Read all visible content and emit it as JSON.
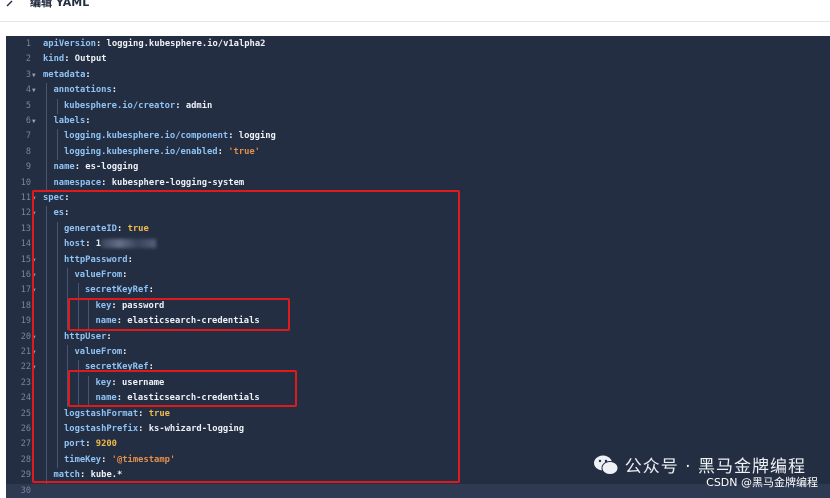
{
  "header": {
    "title": "编辑 YAML"
  },
  "editor": {
    "lines": [
      {
        "n": "1",
        "fold": "",
        "indent": 0,
        "parts": [
          [
            "key",
            "apiVersion"
          ],
          [
            "plain",
            ": logging.kubesphere.io/v1alpha2"
          ]
        ]
      },
      {
        "n": "2",
        "fold": "",
        "indent": 0,
        "parts": [
          [
            "key",
            "kind"
          ],
          [
            "plain",
            ": Output"
          ]
        ]
      },
      {
        "n": "3",
        "fold": "▼",
        "indent": 0,
        "parts": [
          [
            "key",
            "metadata"
          ],
          [
            "plain",
            ":"
          ]
        ]
      },
      {
        "n": "4",
        "fold": "▼",
        "indent": 1,
        "parts": [
          [
            "key",
            "annotations"
          ],
          [
            "plain",
            ":"
          ]
        ]
      },
      {
        "n": "5",
        "fold": "",
        "indent": 2,
        "parts": [
          [
            "key",
            "kubesphere.io/creator"
          ],
          [
            "plain",
            ": admin"
          ]
        ]
      },
      {
        "n": "6",
        "fold": "▼",
        "indent": 1,
        "parts": [
          [
            "key",
            "labels"
          ],
          [
            "plain",
            ":"
          ]
        ]
      },
      {
        "n": "7",
        "fold": "",
        "indent": 2,
        "parts": [
          [
            "key",
            "logging.kubesphere.io/component"
          ],
          [
            "plain",
            ": logging"
          ]
        ]
      },
      {
        "n": "8",
        "fold": "",
        "indent": 2,
        "parts": [
          [
            "key",
            "logging.kubesphere.io/enabled"
          ],
          [
            "plain",
            ": "
          ],
          [
            "str",
            "'true'"
          ]
        ]
      },
      {
        "n": "9",
        "fold": "",
        "indent": 1,
        "parts": [
          [
            "key",
            "name"
          ],
          [
            "plain",
            ": es-logging"
          ]
        ]
      },
      {
        "n": "10",
        "fold": "",
        "indent": 1,
        "parts": [
          [
            "key",
            "namespace"
          ],
          [
            "plain",
            ": kubesphere-logging-system"
          ]
        ]
      },
      {
        "n": "11",
        "fold": "▼",
        "indent": 0,
        "parts": [
          [
            "key",
            "spec"
          ],
          [
            "plain",
            ":"
          ]
        ]
      },
      {
        "n": "12",
        "fold": "▼",
        "indent": 1,
        "parts": [
          [
            "key",
            "es"
          ],
          [
            "plain",
            ":"
          ]
        ]
      },
      {
        "n": "13",
        "fold": "",
        "indent": 2,
        "parts": [
          [
            "key",
            "generateID"
          ],
          [
            "plain",
            ": "
          ],
          [
            "bool",
            "true"
          ]
        ]
      },
      {
        "n": "14",
        "fold": "",
        "indent": 2,
        "parts": [
          [
            "key",
            "host"
          ],
          [
            "plain",
            ": 1"
          ],
          [
            "blur",
            ""
          ]
        ]
      },
      {
        "n": "15",
        "fold": "▼",
        "indent": 2,
        "parts": [
          [
            "key",
            "httpPassword"
          ],
          [
            "plain",
            ":"
          ]
        ]
      },
      {
        "n": "16",
        "fold": "▼",
        "indent": 3,
        "parts": [
          [
            "key",
            "valueFrom"
          ],
          [
            "plain",
            ":"
          ]
        ]
      },
      {
        "n": "17",
        "fold": "▼",
        "indent": 4,
        "parts": [
          [
            "key",
            "secretKeyRef"
          ],
          [
            "plain",
            ":"
          ]
        ]
      },
      {
        "n": "18",
        "fold": "",
        "indent": 5,
        "parts": [
          [
            "key",
            "key"
          ],
          [
            "plain",
            ": password"
          ]
        ]
      },
      {
        "n": "19",
        "fold": "",
        "indent": 5,
        "parts": [
          [
            "key",
            "name"
          ],
          [
            "plain",
            ": elasticsearch-credentials"
          ]
        ]
      },
      {
        "n": "20",
        "fold": "▼",
        "indent": 2,
        "parts": [
          [
            "key",
            "httpUser"
          ],
          [
            "plain",
            ":"
          ]
        ]
      },
      {
        "n": "21",
        "fold": "▼",
        "indent": 3,
        "parts": [
          [
            "key",
            "valueFrom"
          ],
          [
            "plain",
            ":"
          ]
        ]
      },
      {
        "n": "22",
        "fold": "▼",
        "indent": 4,
        "parts": [
          [
            "key",
            "secretKeyRef"
          ],
          [
            "plain",
            ":"
          ]
        ]
      },
      {
        "n": "23",
        "fold": "",
        "indent": 5,
        "parts": [
          [
            "key",
            "key"
          ],
          [
            "plain",
            ": username"
          ]
        ]
      },
      {
        "n": "24",
        "fold": "",
        "indent": 5,
        "parts": [
          [
            "key",
            "name"
          ],
          [
            "plain",
            ": elasticsearch-credentials"
          ]
        ]
      },
      {
        "n": "25",
        "fold": "",
        "indent": 2,
        "parts": [
          [
            "key",
            "logstashFormat"
          ],
          [
            "plain",
            ": "
          ],
          [
            "bool",
            "true"
          ]
        ]
      },
      {
        "n": "26",
        "fold": "",
        "indent": 2,
        "parts": [
          [
            "key",
            "logstashPrefix"
          ],
          [
            "plain",
            ": ks-whizard-logging"
          ]
        ]
      },
      {
        "n": "27",
        "fold": "",
        "indent": 2,
        "parts": [
          [
            "key",
            "port"
          ],
          [
            "plain",
            ": "
          ],
          [
            "num",
            "9200"
          ]
        ]
      },
      {
        "n": "28",
        "fold": "",
        "indent": 2,
        "parts": [
          [
            "key",
            "timeKey"
          ],
          [
            "plain",
            ": "
          ],
          [
            "str",
            "'@timestamp'"
          ]
        ]
      },
      {
        "n": "29",
        "fold": "",
        "indent": 1,
        "parts": [
          [
            "key",
            "match"
          ],
          [
            "plain",
            ": kube.*"
          ]
        ]
      },
      {
        "n": "30",
        "fold": "",
        "indent": 0,
        "parts": []
      }
    ]
  },
  "watermark": {
    "text": "公众号 · 黑马金牌编程",
    "credit": "CSDN @黑马金牌编程"
  }
}
